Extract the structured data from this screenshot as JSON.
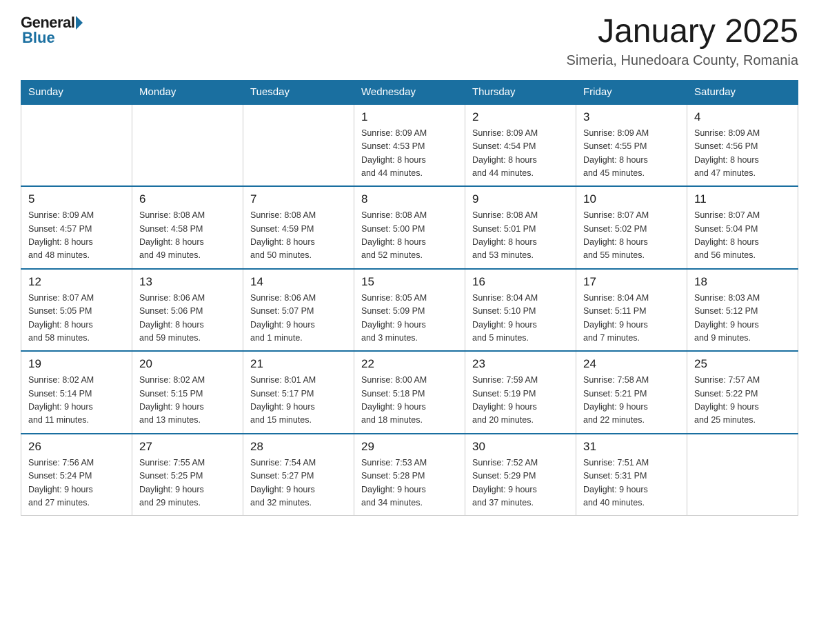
{
  "header": {
    "logo_general": "General",
    "logo_blue": "Blue",
    "title": "January 2025",
    "location": "Simeria, Hunedoara County, Romania"
  },
  "days_of_week": [
    "Sunday",
    "Monday",
    "Tuesday",
    "Wednesday",
    "Thursday",
    "Friday",
    "Saturday"
  ],
  "weeks": [
    [
      {
        "day": "",
        "info": ""
      },
      {
        "day": "",
        "info": ""
      },
      {
        "day": "",
        "info": ""
      },
      {
        "day": "1",
        "info": "Sunrise: 8:09 AM\nSunset: 4:53 PM\nDaylight: 8 hours\nand 44 minutes."
      },
      {
        "day": "2",
        "info": "Sunrise: 8:09 AM\nSunset: 4:54 PM\nDaylight: 8 hours\nand 44 minutes."
      },
      {
        "day": "3",
        "info": "Sunrise: 8:09 AM\nSunset: 4:55 PM\nDaylight: 8 hours\nand 45 minutes."
      },
      {
        "day": "4",
        "info": "Sunrise: 8:09 AM\nSunset: 4:56 PM\nDaylight: 8 hours\nand 47 minutes."
      }
    ],
    [
      {
        "day": "5",
        "info": "Sunrise: 8:09 AM\nSunset: 4:57 PM\nDaylight: 8 hours\nand 48 minutes."
      },
      {
        "day": "6",
        "info": "Sunrise: 8:08 AM\nSunset: 4:58 PM\nDaylight: 8 hours\nand 49 minutes."
      },
      {
        "day": "7",
        "info": "Sunrise: 8:08 AM\nSunset: 4:59 PM\nDaylight: 8 hours\nand 50 minutes."
      },
      {
        "day": "8",
        "info": "Sunrise: 8:08 AM\nSunset: 5:00 PM\nDaylight: 8 hours\nand 52 minutes."
      },
      {
        "day": "9",
        "info": "Sunrise: 8:08 AM\nSunset: 5:01 PM\nDaylight: 8 hours\nand 53 minutes."
      },
      {
        "day": "10",
        "info": "Sunrise: 8:07 AM\nSunset: 5:02 PM\nDaylight: 8 hours\nand 55 minutes."
      },
      {
        "day": "11",
        "info": "Sunrise: 8:07 AM\nSunset: 5:04 PM\nDaylight: 8 hours\nand 56 minutes."
      }
    ],
    [
      {
        "day": "12",
        "info": "Sunrise: 8:07 AM\nSunset: 5:05 PM\nDaylight: 8 hours\nand 58 minutes."
      },
      {
        "day": "13",
        "info": "Sunrise: 8:06 AM\nSunset: 5:06 PM\nDaylight: 8 hours\nand 59 minutes."
      },
      {
        "day": "14",
        "info": "Sunrise: 8:06 AM\nSunset: 5:07 PM\nDaylight: 9 hours\nand 1 minute."
      },
      {
        "day": "15",
        "info": "Sunrise: 8:05 AM\nSunset: 5:09 PM\nDaylight: 9 hours\nand 3 minutes."
      },
      {
        "day": "16",
        "info": "Sunrise: 8:04 AM\nSunset: 5:10 PM\nDaylight: 9 hours\nand 5 minutes."
      },
      {
        "day": "17",
        "info": "Sunrise: 8:04 AM\nSunset: 5:11 PM\nDaylight: 9 hours\nand 7 minutes."
      },
      {
        "day": "18",
        "info": "Sunrise: 8:03 AM\nSunset: 5:12 PM\nDaylight: 9 hours\nand 9 minutes."
      }
    ],
    [
      {
        "day": "19",
        "info": "Sunrise: 8:02 AM\nSunset: 5:14 PM\nDaylight: 9 hours\nand 11 minutes."
      },
      {
        "day": "20",
        "info": "Sunrise: 8:02 AM\nSunset: 5:15 PM\nDaylight: 9 hours\nand 13 minutes."
      },
      {
        "day": "21",
        "info": "Sunrise: 8:01 AM\nSunset: 5:17 PM\nDaylight: 9 hours\nand 15 minutes."
      },
      {
        "day": "22",
        "info": "Sunrise: 8:00 AM\nSunset: 5:18 PM\nDaylight: 9 hours\nand 18 minutes."
      },
      {
        "day": "23",
        "info": "Sunrise: 7:59 AM\nSunset: 5:19 PM\nDaylight: 9 hours\nand 20 minutes."
      },
      {
        "day": "24",
        "info": "Sunrise: 7:58 AM\nSunset: 5:21 PM\nDaylight: 9 hours\nand 22 minutes."
      },
      {
        "day": "25",
        "info": "Sunrise: 7:57 AM\nSunset: 5:22 PM\nDaylight: 9 hours\nand 25 minutes."
      }
    ],
    [
      {
        "day": "26",
        "info": "Sunrise: 7:56 AM\nSunset: 5:24 PM\nDaylight: 9 hours\nand 27 minutes."
      },
      {
        "day": "27",
        "info": "Sunrise: 7:55 AM\nSunset: 5:25 PM\nDaylight: 9 hours\nand 29 minutes."
      },
      {
        "day": "28",
        "info": "Sunrise: 7:54 AM\nSunset: 5:27 PM\nDaylight: 9 hours\nand 32 minutes."
      },
      {
        "day": "29",
        "info": "Sunrise: 7:53 AM\nSunset: 5:28 PM\nDaylight: 9 hours\nand 34 minutes."
      },
      {
        "day": "30",
        "info": "Sunrise: 7:52 AM\nSunset: 5:29 PM\nDaylight: 9 hours\nand 37 minutes."
      },
      {
        "day": "31",
        "info": "Sunrise: 7:51 AM\nSunset: 5:31 PM\nDaylight: 9 hours\nand 40 minutes."
      },
      {
        "day": "",
        "info": ""
      }
    ]
  ]
}
